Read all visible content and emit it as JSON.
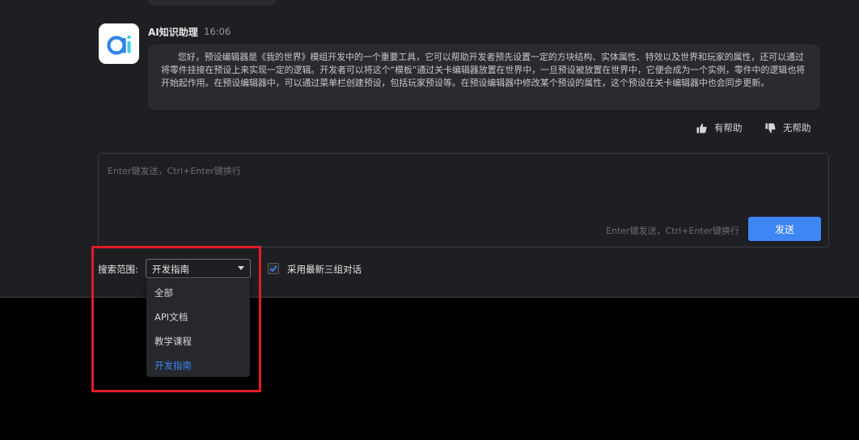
{
  "message": {
    "bot_name": "AI知识助理",
    "time": "16:06",
    "text": "您好，预设编辑器是《我的世界》模组开发中的一个重要工具，它可以帮助开发者预先设置一定的方块结构、实体属性、特效以及世界和玩家的属性，还可以通过将零件挂接在预设上来实现一定的逻辑。开发者可以将这个“模板”通过关卡编辑器放置在世界中，一旦预设被放置在世界中，它便会成为一个实例，零件中的逻辑也将开始起作用。在预设编辑器中，可以通过菜单栏创建预设，包括玩家预设等。在预设编辑器中修改某个预设的属性，这个预设在关卡编辑器中也会同步更新。"
  },
  "feedback": {
    "helpful": "有帮助",
    "unhelpful": "无帮助"
  },
  "composer": {
    "placeholder": "Enter键发送，Ctrl+Enter键换行",
    "hint": "Enter键发送，Ctrl+Enter键换行",
    "send_label": "发送"
  },
  "search": {
    "scope_label": "搜索范围:",
    "selected": "开发指南",
    "options": [
      "全部",
      "API文档",
      "教学课程",
      "开发指南"
    ],
    "checkbox_label": "采用最新三组对话",
    "checkbox_checked": true
  },
  "colors": {
    "accent": "#3d86f4",
    "annotation": "#e31b24",
    "panel": "#1e1f22",
    "bubble": "#2a2b2f"
  },
  "icons": {
    "avatar": "ai-logo-icon",
    "helpful": "thumbs-up-icon",
    "unhelpful": "thumbs-down-icon",
    "caret": "caret-down-icon",
    "check": "check-icon"
  }
}
